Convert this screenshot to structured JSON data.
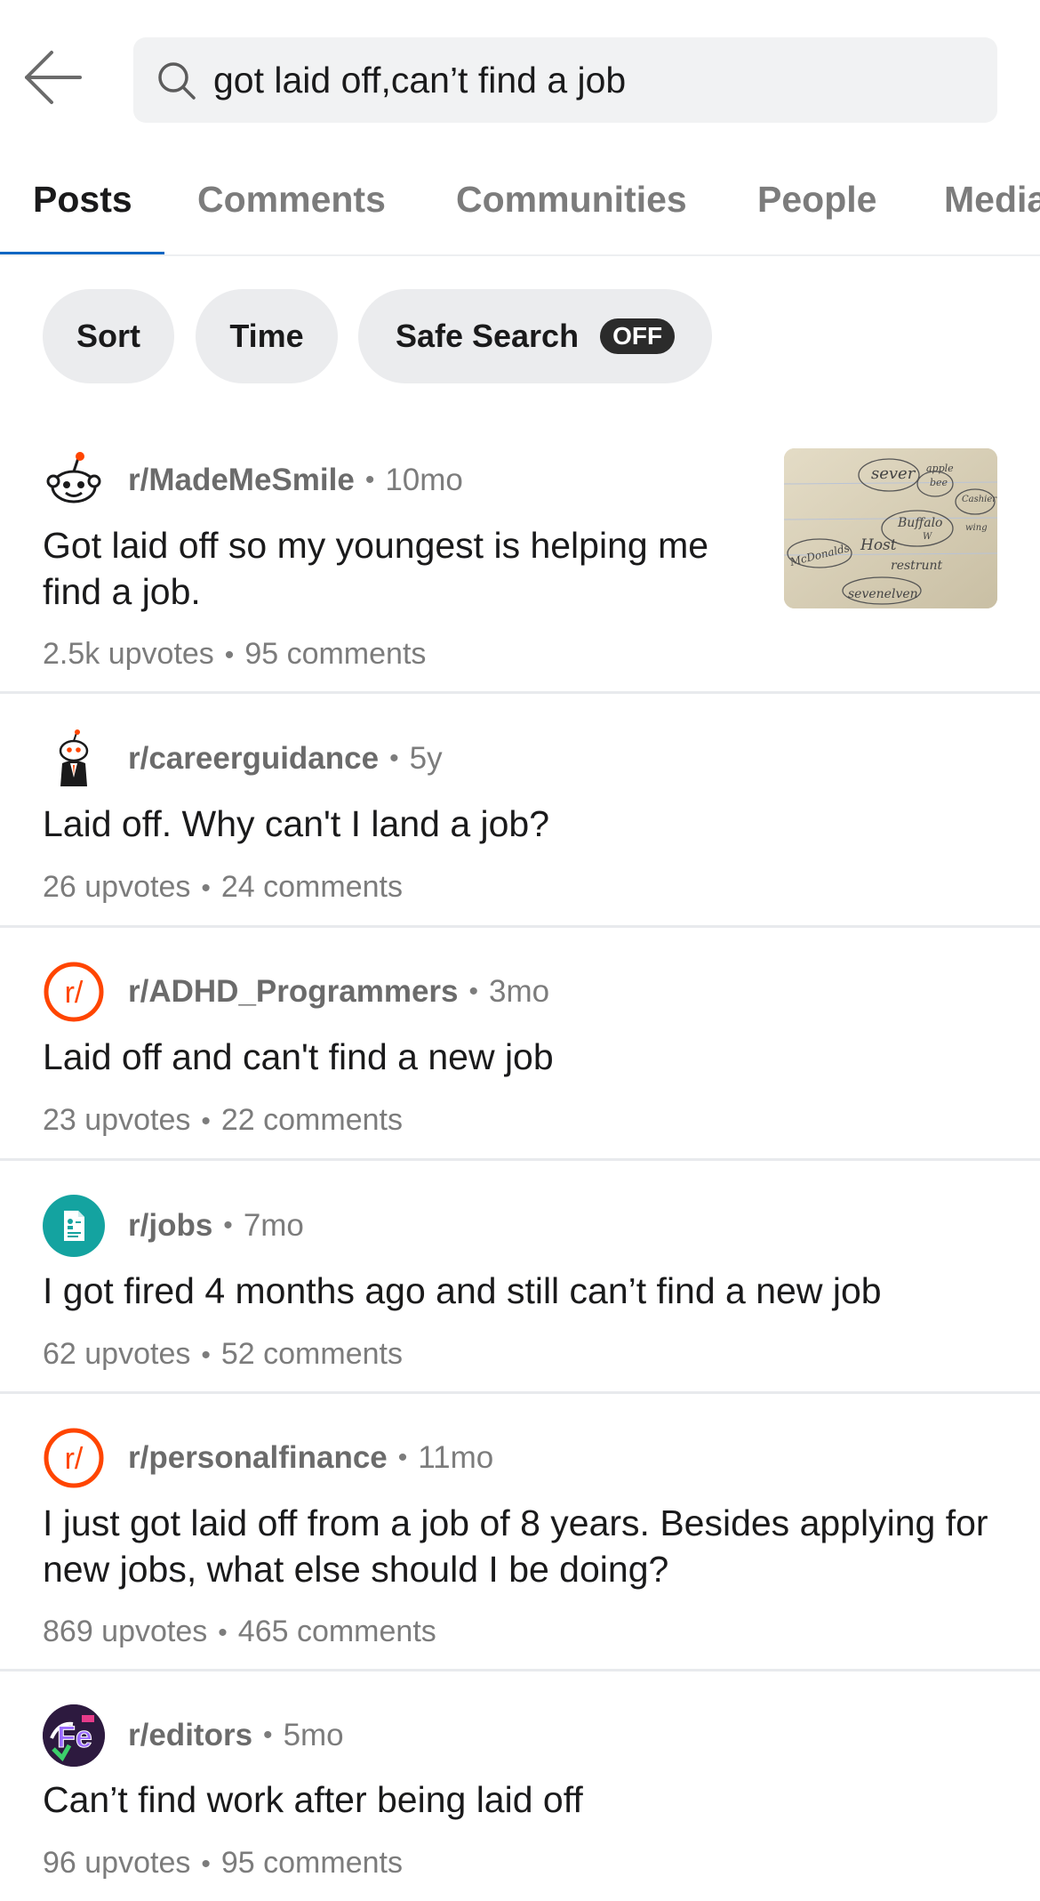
{
  "search": {
    "query": "got laid off,can’t find a job"
  },
  "tabs": [
    {
      "label": "Posts",
      "active": true
    },
    {
      "label": "Comments"
    },
    {
      "label": "Communities"
    },
    {
      "label": "People"
    },
    {
      "label": "Media"
    }
  ],
  "filters": {
    "sort": "Sort",
    "time": "Time",
    "safe_search": "Safe Search",
    "safe_search_state": "OFF"
  },
  "thumbnail_words": [
    "sever",
    "apple",
    "bee",
    "Buffalo",
    "W",
    "Cashier",
    "wing",
    "McDonalds",
    "Host",
    "restrunt",
    "sevenelven"
  ],
  "posts": [
    {
      "subreddit": "r/MadeMeSmile",
      "age": "10mo",
      "title": "Got laid off so my youngest is helping me find a job.",
      "upvotes": "2.5k upvotes",
      "comments": "95 comments",
      "avatar": "snoo-smile-icon",
      "has_thumbnail": true
    },
    {
      "subreddit": "r/careerguidance",
      "age": "5y",
      "title": "Laid off. Why can't I land a job?",
      "upvotes": "26 upvotes",
      "comments": "24 comments",
      "avatar": "snoo-suit-icon"
    },
    {
      "subreddit": "r/ADHD_Programmers",
      "age": "3mo",
      "title": "Laid off and can't find a new job",
      "upvotes": "23 upvotes",
      "comments": "22 comments",
      "avatar": "reddit-r-icon"
    },
    {
      "subreddit": "r/jobs",
      "age": "7mo",
      "title": "I got fired 4 months ago and still can’t find a new job",
      "upvotes": "62 upvotes",
      "comments": "52 comments",
      "avatar": "document-icon"
    },
    {
      "subreddit": "r/personalfinance",
      "age": "11mo",
      "title": "I just got laid off from a job of 8 years. Besides applying for new jobs, what else should I be doing?",
      "upvotes": "869 upvotes",
      "comments": "465 comments",
      "avatar": "reddit-r-icon"
    },
    {
      "subreddit": "r/editors",
      "age": "5mo",
      "title": "Can’t find work after being laid off",
      "upvotes": "96 upvotes",
      "comments": "95 comments",
      "avatar": "editors-logo-icon"
    }
  ],
  "colors": {
    "accent_blue": "#0a66c2",
    "reddit_orange": "#ff4500",
    "jobs_teal": "#14a3a0",
    "muted_text": "#7c7c7c"
  }
}
